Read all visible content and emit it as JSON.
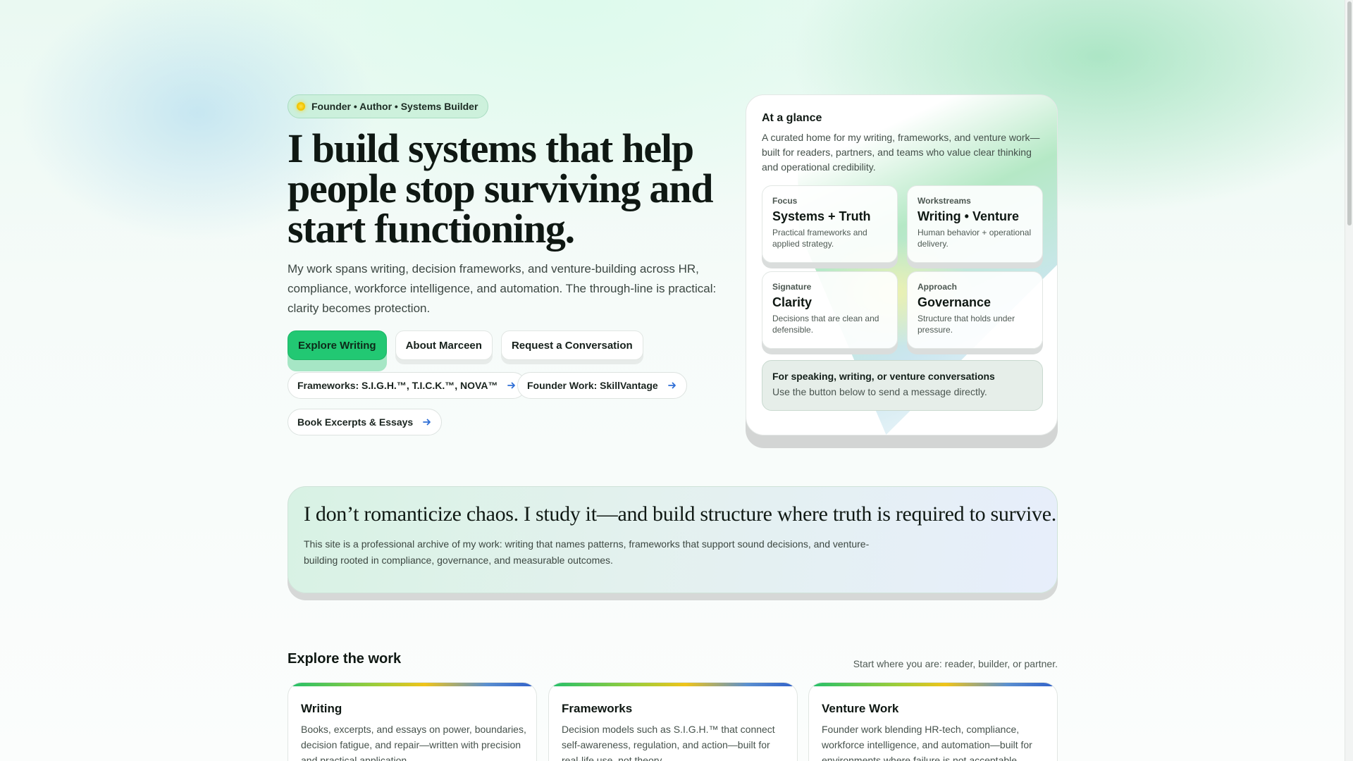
{
  "hero": {
    "tagline": "Founder • Author • Systems Builder",
    "headline": "I build systems that help people stop surviving and start functioning.",
    "intro": "My work spans writing, decision frameworks, and venture-building across HR, compliance, workforce intelligence, and automation. The through-line is practical: clarity becomes protection.",
    "buttons": {
      "explore": "Explore Writing",
      "about": "About Marceen",
      "request": "Request a Conversation"
    },
    "pills": [
      "Frameworks: S.I.G.H.™, T.I.C.K.™, NOVA™",
      "Founder Work: SkillVantage",
      "Book Excerpts & Essays"
    ]
  },
  "glance": {
    "title": "At a glance",
    "description": "A curated home for my writing, frameworks, and venture work—built for readers, partners, and teams who value clear thinking and operational credibility.",
    "items": [
      {
        "label": "Focus",
        "value": "Systems + Truth",
        "sub": "Practical frameworks and applied strategy."
      },
      {
        "label": "Workstreams",
        "value": "Writing • Venture",
        "sub": "Human behavior + operational delivery."
      },
      {
        "label": "Signature",
        "value": "Clarity",
        "sub": "Decisions that are clean and defensible."
      },
      {
        "label": "Approach",
        "value": "Governance",
        "sub": "Structure that holds under pressure."
      }
    ],
    "speaking": {
      "title": "For speaking, writing, or venture conversations",
      "sub": "Use the button below to send a message directly."
    }
  },
  "quote": {
    "text": "I don’t romanticize chaos. I study it—and build structure where truth is required to survive.",
    "body": "This site is a professional archive of my work: writing that names patterns, frameworks that support sound decisions, and venture-building rooted in compliance, governance, and measurable outcomes."
  },
  "explore": {
    "title": "Explore the work",
    "subtitle": "Start where you are: reader, builder, or partner.",
    "cards": [
      {
        "title": "Writing",
        "desc": "Books, excerpts, and essays on power, boundaries, decision fatigue, and repair—written with precision and practical application."
      },
      {
        "title": "Frameworks",
        "desc": "Decision models such as S.I.G.H.™ that connect self-awareness, regulation, and action—built for real-life use, not theory."
      },
      {
        "title": "Venture Work",
        "desc": "Founder work blending HR-tech, compliance, workforce intelligence, and automation—built for environments where failure is not acceptable."
      }
    ]
  },
  "icons": {
    "tagline_dot": "sun-dot-icon",
    "pill_arrow": "arrow-right-icon"
  },
  "colors": {
    "accent": "#22c873",
    "arrow": "#2f6fd6"
  }
}
